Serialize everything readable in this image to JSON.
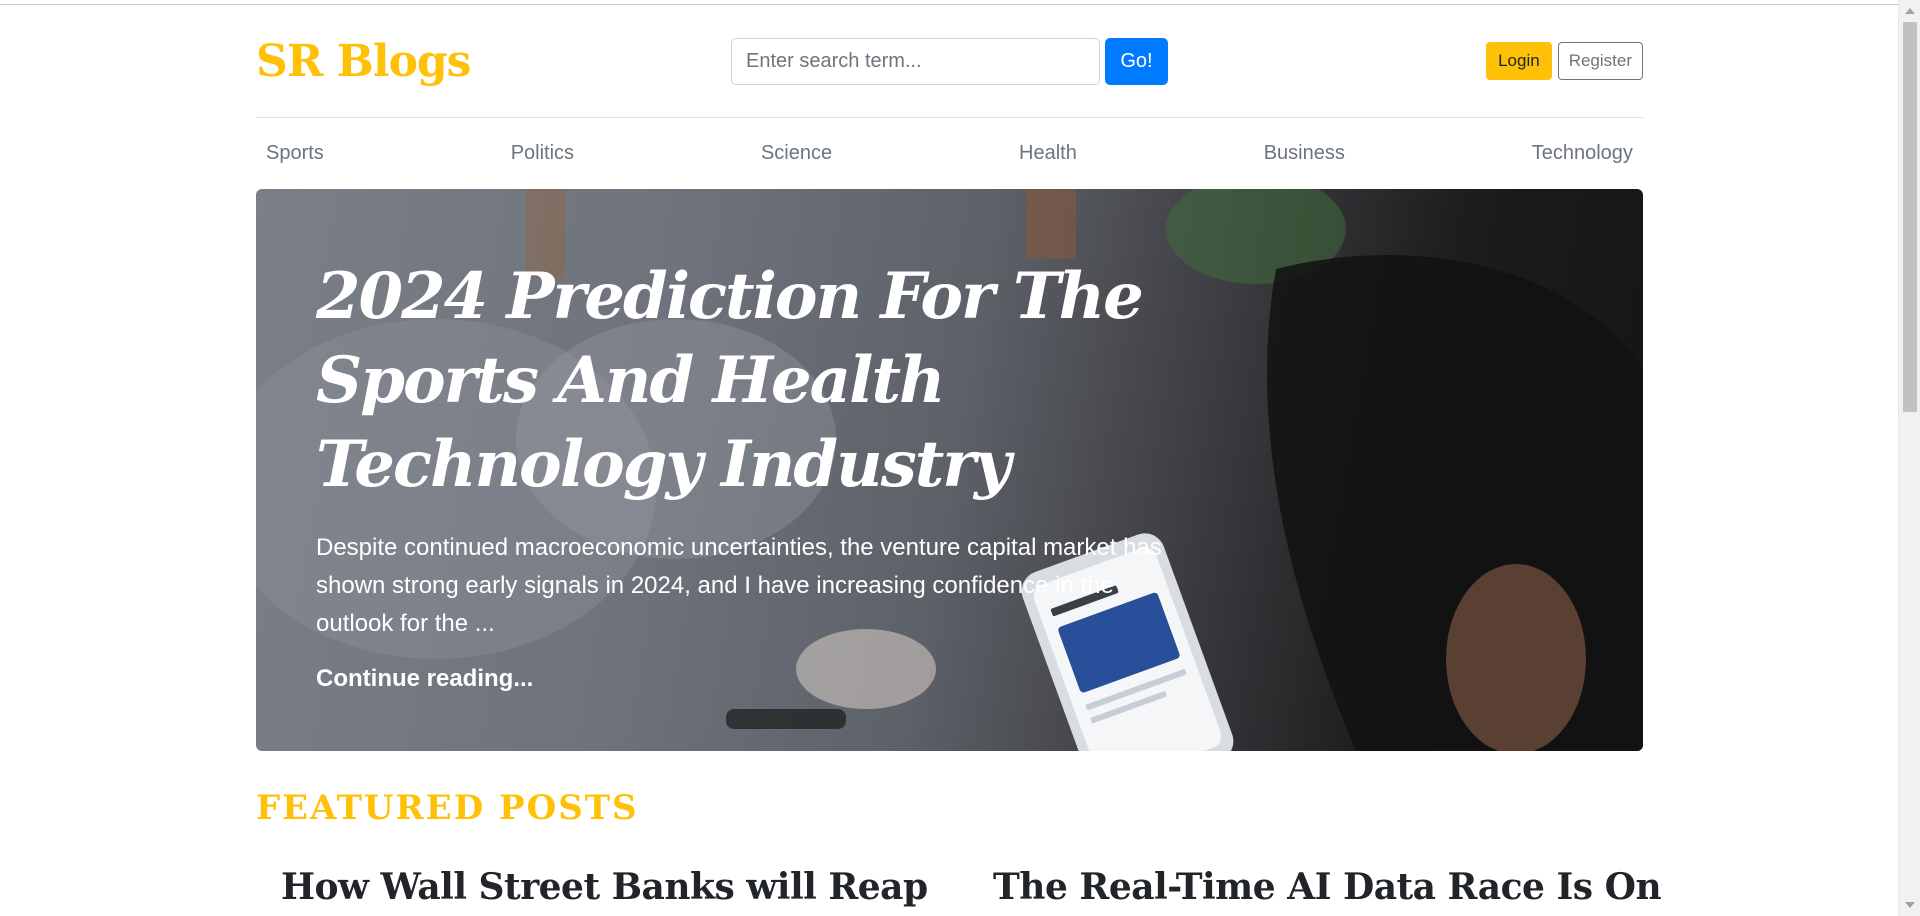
{
  "brand": {
    "logo_text": "SR Blogs",
    "accent_color": "#ffc107"
  },
  "search": {
    "placeholder": "Enter search term...",
    "go_label": "Go!"
  },
  "auth": {
    "login_label": "Login",
    "register_label": "Register"
  },
  "nav": {
    "items": [
      "Sports",
      "Politics",
      "Science",
      "Health",
      "Business",
      "Technology"
    ]
  },
  "hero": {
    "title": "2024 Prediction For The Sports And Health Technology Industry",
    "excerpt": "Despite continued macroeconomic uncertainties, the venture capital market has shown strong early signals in 2024, and I have increasing confidence in the outlook for the ...",
    "continue_label": "Continue reading...",
    "image_icon": "phone-photo"
  },
  "featured": {
    "heading": "FEATURED POSTS",
    "posts": [
      {
        "title": "How Wall Street Banks will Reap"
      },
      {
        "title": "The Real-Time AI Data Race Is On"
      }
    ]
  }
}
